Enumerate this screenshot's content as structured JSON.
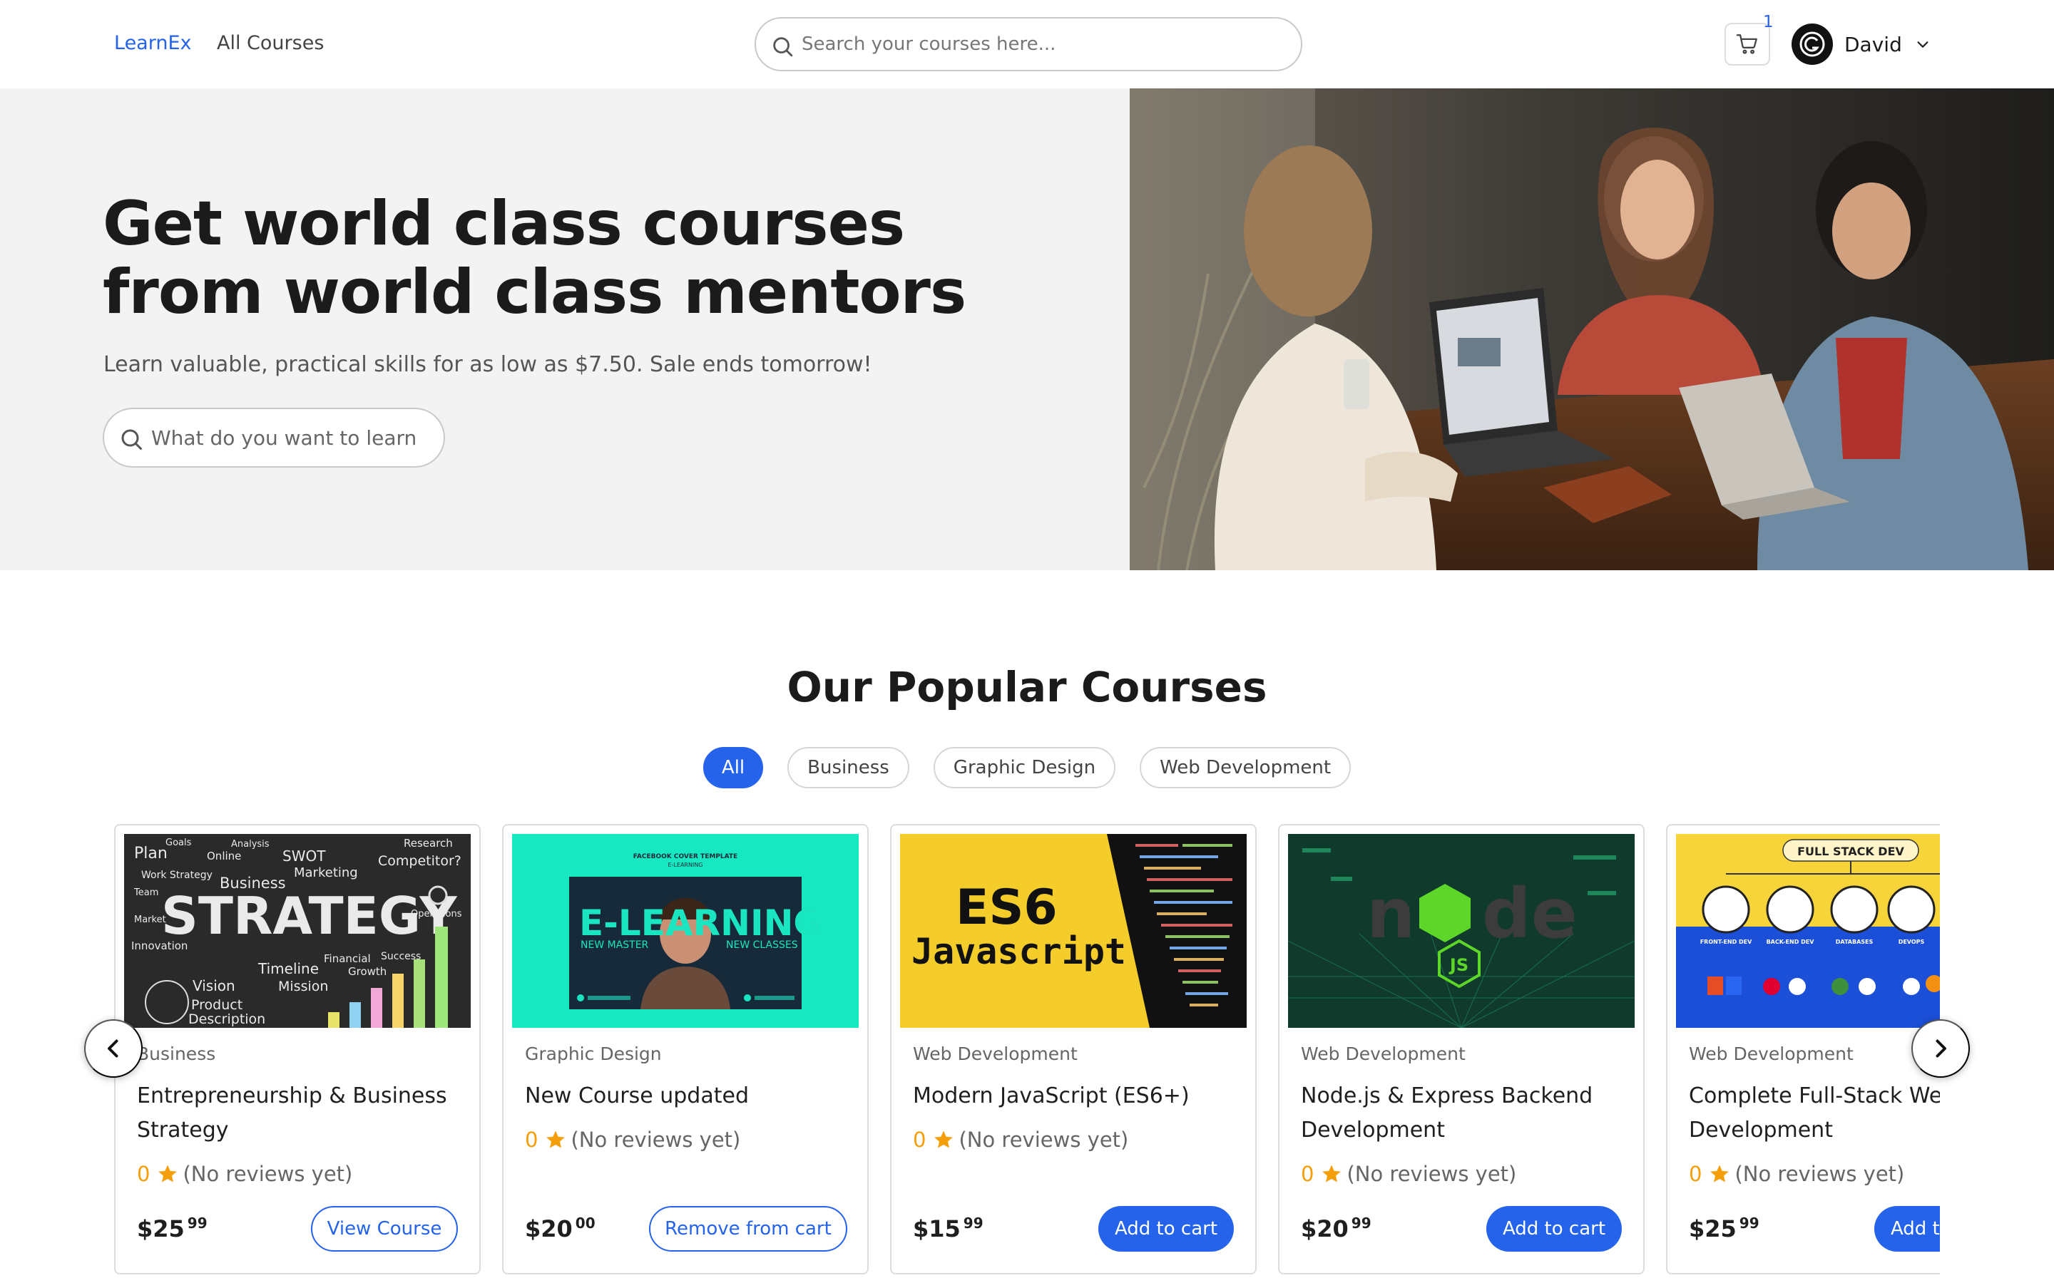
{
  "nav": {
    "brand": "LearnEx",
    "all_courses": "All Courses",
    "search_placeholder": "Search your courses here...",
    "cart_count": "1",
    "user_name": "David"
  },
  "hero": {
    "title": "Get world class courses from world class mentors",
    "subtitle": "Learn valuable, practical skills for as low as $7.50. Sale ends tomorrow!",
    "search_placeholder": "What do you want to learn"
  },
  "popular": {
    "title": "Our Popular Courses",
    "filters": [
      "All",
      "Business",
      "Graphic Design",
      "Web Development"
    ],
    "active_filter": "All"
  },
  "courses": [
    {
      "category": "Business",
      "title": "Entrepreneurship & Business Strategy",
      "rating": "0",
      "reviews": "(No reviews yet)",
      "price_whole": "$25",
      "price_cents": "99",
      "button": "View Course",
      "thumb_words": [
        "Plan",
        "Goals",
        "Analysis",
        "Online",
        "SWOT",
        "Research",
        "Competitor?",
        "Work Strategy",
        "Marketing",
        "Business",
        "Team",
        "STRATEGY",
        "Market",
        "Operations",
        "Innovation",
        "Financial",
        "Success",
        "Timeline",
        "Growth",
        "Vision",
        "Mission",
        "Product",
        "Description"
      ]
    },
    {
      "category": "Graphic Design",
      "title": "New Course updated",
      "rating": "0",
      "reviews": "(No reviews yet)",
      "price_whole": "$20",
      "price_cents": "00",
      "button": "Remove from cart",
      "thumb_header": "FACEBOOK COVER TEMPLATE",
      "thumb_header2": "E-LEARNING",
      "thumb_title": "E-LEARNING",
      "thumb_sub_left": "NEW MASTER",
      "thumb_sub_right": "NEW CLASSES"
    },
    {
      "category": "Web Development",
      "title": "Modern JavaScript (ES6+)",
      "rating": "0",
      "reviews": "(No reviews yet)",
      "price_whole": "$15",
      "price_cents": "99",
      "button": "Add to cart",
      "thumb_title": "ES6",
      "thumb_sub": "Javascript"
    },
    {
      "category": "Web Development",
      "title": "Node.js & Express Backend Development",
      "rating": "0",
      "reviews": "(No reviews yet)",
      "price_whole": "$20",
      "price_cents": "99",
      "button": "Add to cart",
      "thumb_n": "n",
      "thumb_de": "de",
      "thumb_js": "JS"
    },
    {
      "category": "Web Development",
      "title": "Complete Full-Stack Web Development",
      "rating": "0",
      "reviews": "(No reviews yet)",
      "price_whole": "$25",
      "price_cents": "99",
      "button": "Add to cart",
      "thumb_title": "FULL STACK DEV",
      "thumb_cols": [
        "FRONT-END DEV",
        "BACK-END DEV",
        "DATABASES",
        "DEVOPS"
      ]
    }
  ],
  "colors": {
    "accent": "#2563eb",
    "star": "#f59e0b",
    "hero_bg": "#f3f3f3"
  },
  "icons": [
    "search-icon",
    "cart-icon",
    "avatar-icon",
    "chevron-down-icon",
    "star-icon",
    "chevron-left-icon",
    "chevron-right-icon"
  ]
}
